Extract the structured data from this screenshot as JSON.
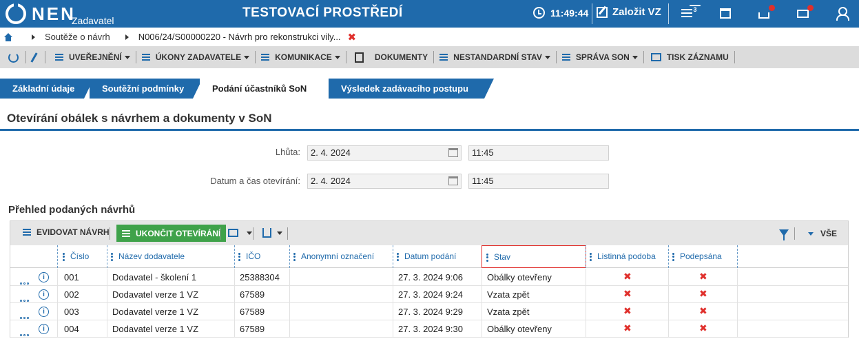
{
  "header": {
    "logo": "NEN",
    "logo_sub": "Zadavatel",
    "env_title": "TESTOVACÍ PROSTŘEDÍ",
    "time": "11:49:44",
    "create_label": "Založit VZ",
    "menu_badge": "3"
  },
  "breadcrumb": {
    "items": [
      "Soutěže o návrh",
      "N006/24/S00000220 - Návrh pro rekonstrukci vily..."
    ],
    "close": "✖"
  },
  "toolbar": {
    "uverejneni": "UVEŘEJNĚNÍ",
    "ukony": "ÚKONY ZADAVATELE",
    "komunikace": "KOMUNIKACE",
    "dokumenty": "DOKUMENTY",
    "nestandardni": "NESTANDARDNÍ STAV",
    "sprava": "SPRÁVA SON",
    "tisk": "TISK ZÁZNAMU"
  },
  "tabs": [
    {
      "label": "Základní údaje"
    },
    {
      "label": "Soutěžní podmínky"
    },
    {
      "label": "Podání účastníků SoN"
    },
    {
      "label": "Výsledek zadávacího postupu"
    }
  ],
  "section_title": "Otevírání obálek s návrhem a dokumenty v SoN",
  "form": {
    "lhuta_label": "Lhůta:",
    "lhuta_date": "2. 4. 2024",
    "lhuta_time": "11:45",
    "otevreni_label": "Datum a čas otevírání:",
    "otevreni_date": "2. 4. 2024",
    "otevreni_time": "11:45"
  },
  "overview_title": "Přehled podaných návrhů",
  "grid": {
    "evidovat": "EVIDOVAT NÁVRH",
    "ukoncit": "UKONČIT OTEVÍRÁNÍ",
    "vse": "VŠE",
    "columns": [
      "Číslo",
      "Název dodavatele",
      "IČO",
      "Anonymní označení",
      "Datum podání",
      "Stav",
      "Listinná podoba",
      "Podepsána"
    ],
    "rows": [
      {
        "cislo": "001",
        "nazev": "Dodavatel - školení 1",
        "ico": "25388304",
        "anon": "",
        "datum": "27. 3. 2024 9:06",
        "stav": "Obálky otevřeny",
        "listinna": "✖",
        "podepsana": "✖"
      },
      {
        "cislo": "002",
        "nazev": "Dodavatel verze 1 VZ",
        "ico": "67589",
        "anon": "",
        "datum": "27. 3. 2024 9:24",
        "stav": "Vzata zpět",
        "listinna": "✖",
        "podepsana": "✖"
      },
      {
        "cislo": "003",
        "nazev": "Dodavatel verze 1 VZ",
        "ico": "67589",
        "anon": "",
        "datum": "27. 3. 2024 9:29",
        "stav": "Vzata zpět",
        "listinna": "✖",
        "podepsana": "✖"
      },
      {
        "cislo": "004",
        "nazev": "Dodavatel verze 1 VZ",
        "ico": "67589",
        "anon": "",
        "datum": "27. 3. 2024 9:30",
        "stav": "Obálky otevřeny",
        "listinna": "✖",
        "podepsana": "✖"
      }
    ]
  },
  "colors": {
    "brand": "#1f6aab",
    "green": "#3fa24a",
    "red": "#e0302c"
  }
}
